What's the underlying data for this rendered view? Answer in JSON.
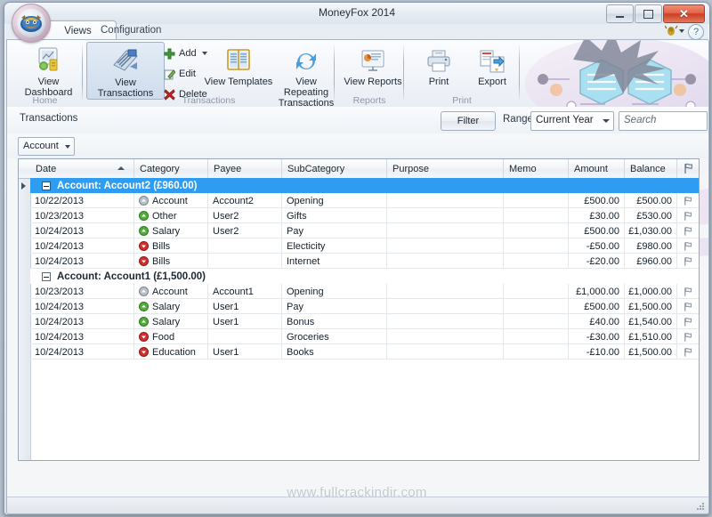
{
  "window": {
    "title": "MoneyFox 2014",
    "minimize_label": "Minimize",
    "maximize_label": "Maximize",
    "close_label": "Close"
  },
  "app_button": {
    "label": "MoneyFox application menu"
  },
  "tabs": [
    {
      "label": "Views",
      "active": true
    },
    {
      "label": "Configuration",
      "active": false
    }
  ],
  "help": {
    "label": "?"
  },
  "ribbon": {
    "groups": [
      {
        "name": "Home",
        "label": "Home",
        "buttons": [
          {
            "label": "View Dashboard",
            "icon": "dashboard-icon"
          }
        ]
      },
      {
        "name": "Transactions",
        "label": "Transactions",
        "buttons": [
          {
            "label": "View Transactions",
            "icon": "transactions-icon",
            "selected": true
          },
          {
            "label": "View Templates",
            "icon": "templates-icon"
          },
          {
            "label": "View Repeating Transactions",
            "icon": "repeating-icon"
          }
        ],
        "small_buttons": [
          {
            "label": "Add",
            "icon": "plus-icon",
            "has_dropdown": true
          },
          {
            "label": "Edit",
            "icon": "edit-icon"
          },
          {
            "label": "Delete",
            "icon": "delete-icon"
          }
        ]
      },
      {
        "name": "Reports",
        "label": "Reports",
        "buttons": [
          {
            "label": "View Reports",
            "icon": "reports-icon"
          }
        ]
      },
      {
        "name": "Print",
        "label": "Print",
        "buttons": [
          {
            "label": "Print",
            "icon": "printer-icon"
          },
          {
            "label": "Export",
            "icon": "export-icon"
          }
        ]
      }
    ]
  },
  "toolstrip": {
    "breadcrumb": "Transactions",
    "filter_label": "Filter",
    "range_label": "Range",
    "range_value": "Current Year",
    "search_placeholder": "Search"
  },
  "account_selector": {
    "value": "Account"
  },
  "grid": {
    "columns": [
      {
        "key": "date",
        "label": "Date",
        "sorted": "asc"
      },
      {
        "key": "category",
        "label": "Category"
      },
      {
        "key": "payee",
        "label": "Payee"
      },
      {
        "key": "subcategory",
        "label": "SubCategory"
      },
      {
        "key": "purpose",
        "label": "Purpose"
      },
      {
        "key": "memo",
        "label": "Memo"
      },
      {
        "key": "amount",
        "label": "Amount"
      },
      {
        "key": "balance",
        "label": "Balance"
      }
    ],
    "flag_column_icon": "flag-icon",
    "groups": [
      {
        "header": "Account:  Account2 (£960.00)",
        "selected": true,
        "rows": [
          {
            "date": "10/22/2013",
            "category": "Account",
            "cat_icon": "gray-arrow-icon",
            "payee": "Account2",
            "subcategory": "Opening",
            "purpose": "",
            "memo": "",
            "amount": "£500.00",
            "balance": "£500.00"
          },
          {
            "date": "10/23/2013",
            "category": "Other",
            "cat_icon": "green-arrow-icon",
            "payee": "User2",
            "subcategory": "Gifts",
            "purpose": "",
            "memo": "",
            "amount": "£30.00",
            "balance": "£530.00"
          },
          {
            "date": "10/24/2013",
            "category": "Salary",
            "cat_icon": "green-arrow-icon",
            "payee": "User2",
            "subcategory": "Pay",
            "purpose": "",
            "memo": "",
            "amount": "£500.00",
            "balance": "£1,030.00"
          },
          {
            "date": "10/24/2013",
            "category": "Bills",
            "cat_icon": "red-arrow-icon",
            "payee": "",
            "subcategory": "Electicity",
            "purpose": "",
            "memo": "",
            "amount": "-£50.00",
            "balance": "£980.00"
          },
          {
            "date": "10/24/2013",
            "category": "Bills",
            "cat_icon": "red-arrow-icon",
            "payee": "",
            "subcategory": "Internet",
            "purpose": "",
            "memo": "",
            "amount": "-£20.00",
            "balance": "£960.00"
          }
        ]
      },
      {
        "header": "Account:  Account1 (£1,500.00)",
        "selected": false,
        "rows": [
          {
            "date": "10/23/2013",
            "category": "Account",
            "cat_icon": "gray-arrow-icon",
            "payee": "Account1",
            "subcategory": "Opening",
            "purpose": "",
            "memo": "",
            "amount": "£1,000.00",
            "balance": "£1,000.00"
          },
          {
            "date": "10/24/2013",
            "category": "Salary",
            "cat_icon": "green-arrow-icon",
            "payee": "User1",
            "subcategory": "Pay",
            "purpose": "",
            "memo": "",
            "amount": "£500.00",
            "balance": "£1,500.00"
          },
          {
            "date": "10/24/2013",
            "category": "Salary",
            "cat_icon": "green-arrow-icon",
            "payee": "User1",
            "subcategory": "Bonus",
            "purpose": "",
            "memo": "",
            "amount": "£40.00",
            "balance": "£1,540.00"
          },
          {
            "date": "10/24/2013",
            "category": "Food",
            "cat_icon": "red-arrow-icon",
            "payee": "",
            "subcategory": "Groceries",
            "purpose": "",
            "memo": "",
            "amount": "-£30.00",
            "balance": "£1,510.00"
          },
          {
            "date": "10/24/2013",
            "category": "Education",
            "cat_icon": "red-arrow-icon",
            "payee": "User1",
            "subcategory": "Books",
            "purpose": "",
            "memo": "",
            "amount": "-£10.00",
            "balance": "£1,500.00"
          }
        ]
      }
    ]
  },
  "watermark": {
    "text": "www.fullcrackindir.com"
  },
  "colors": {
    "selection_blue": "#2e9cf0",
    "income_green": "#3f9a36",
    "expense_red": "#cb2a2a",
    "accent_close": "#cd3e23"
  }
}
